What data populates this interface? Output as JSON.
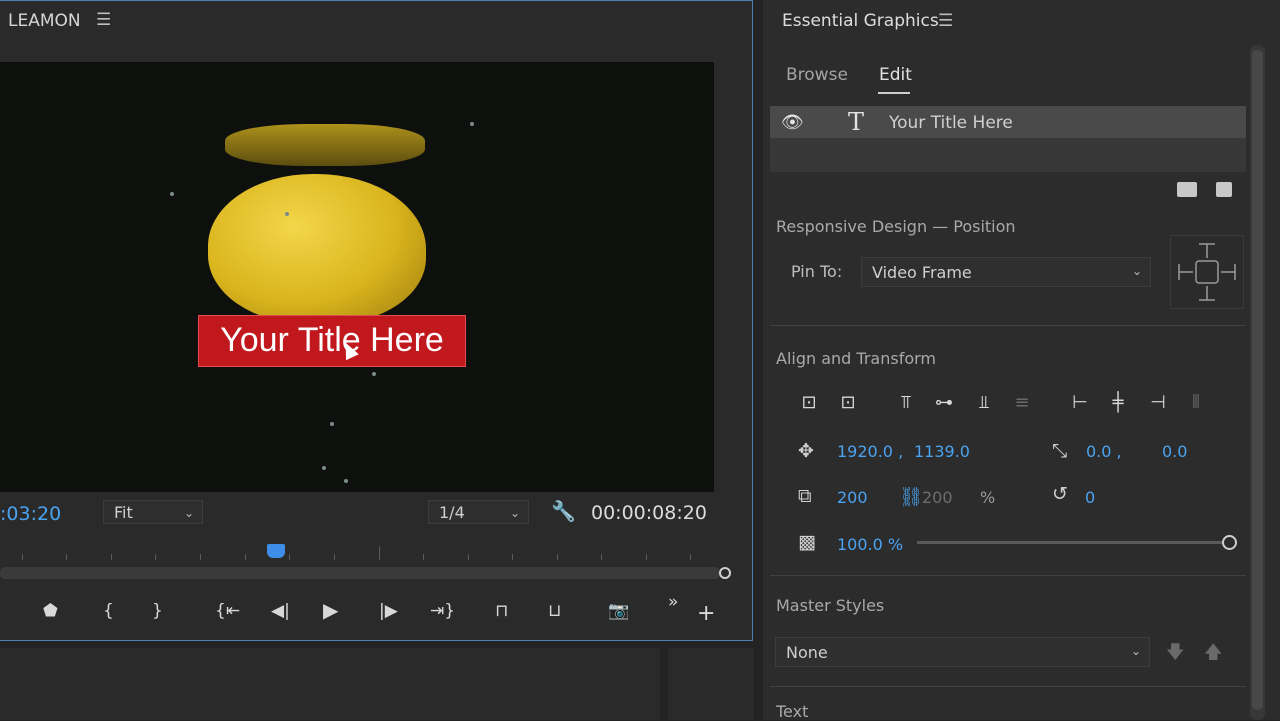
{
  "program_monitor": {
    "title": "LEAMON",
    "menu_icon": "hamburger-menu-icon",
    "video": {
      "title_text": "Your Title Here"
    },
    "timecode_current": ":03:20",
    "zoom": {
      "selected": "Fit"
    },
    "resolution": {
      "selected": "1/4"
    },
    "timecode_duration": "00:00:08:20",
    "transport_icons": [
      "marker-icon",
      "in-point-icon",
      "out-point-icon",
      "go-to-in-icon",
      "step-back-icon",
      "play-icon",
      "step-forward-icon",
      "go-to-out-icon",
      "lift-icon",
      "extract-icon",
      "export-frame-icon",
      "more-icon",
      "add-button-icon"
    ]
  },
  "essential_graphics": {
    "title": "Essential Graphics",
    "tabs": [
      {
        "label": "Browse",
        "active": false
      },
      {
        "label": "Edit",
        "active": true
      }
    ],
    "layers": [
      {
        "name": "Your Title Here",
        "type": "text",
        "visible": true
      }
    ],
    "responsive_design": {
      "header": "Responsive Design — Position",
      "pin_label": "Pin To:",
      "pin_value": "Video Frame"
    },
    "align_transform": {
      "header": "Align and Transform",
      "position_x": "1920.0 ,",
      "position_y": "1139.0",
      "anchor_x": "0.0 ,",
      "anchor_y": "0.0",
      "scale": "200",
      "scale_linked": "200",
      "scale_unit": "%",
      "rotation": "0",
      "opacity": "100.0 %",
      "opacity_fraction": 1.0
    },
    "master_styles": {
      "header": "Master Styles",
      "selected": "None"
    },
    "text_section": {
      "header": "Text"
    }
  },
  "colors": {
    "accent_blue": "#4aa3f0",
    "title_red": "#c0181c",
    "panel_border": "#4a7fb3"
  }
}
